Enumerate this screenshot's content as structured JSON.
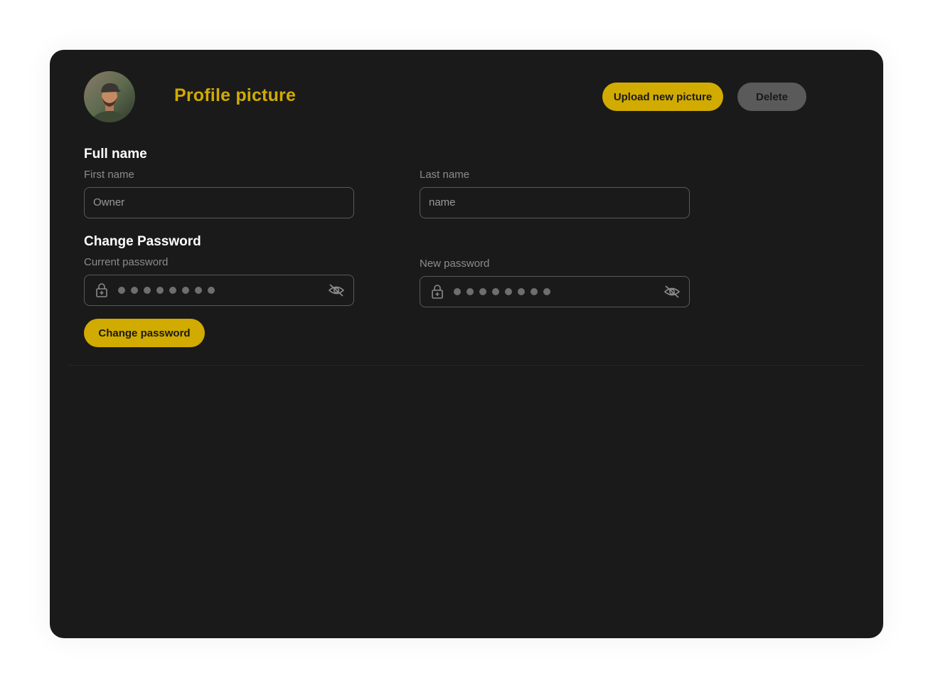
{
  "profile": {
    "title": "Profile picture",
    "upload_label": "Upload new picture",
    "delete_label": "Delete"
  },
  "full_name": {
    "title": "Full name",
    "first_name_label": "First name",
    "first_name_value": "Owner",
    "last_name_label": "Last name",
    "last_name_value": "name"
  },
  "password": {
    "title": "Change Password",
    "current_label": "Current password",
    "current_masked_length": 8,
    "new_label": "New password",
    "new_masked_length": 8,
    "change_label": "Change password"
  },
  "colors": {
    "accent": "#d1ab00",
    "card_background": "#1a1a1a",
    "muted_button": "#5a5a5a",
    "label": "#8c8c8c"
  },
  "icons": {
    "lock": "lock-icon",
    "eye_off": "eye-off-icon"
  }
}
